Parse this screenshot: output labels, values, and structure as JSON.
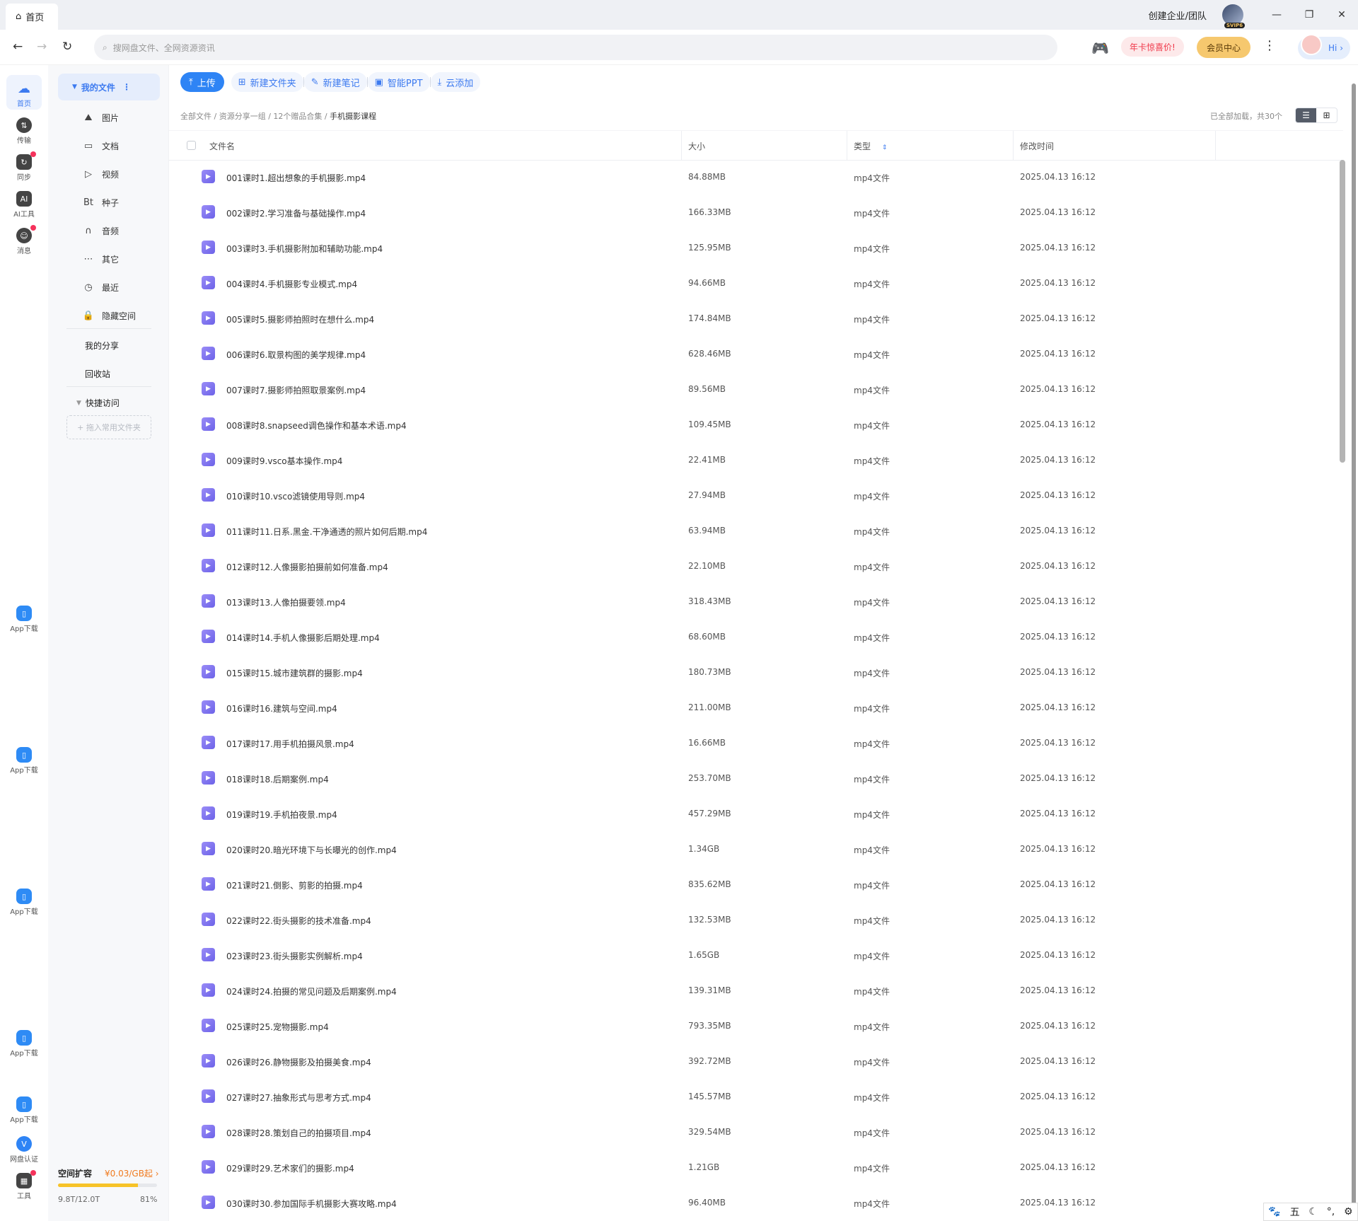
{
  "titlebar": {
    "tab_label": "首页",
    "team_label": "创建企业/团队",
    "svip_badge": "SVIP6"
  },
  "search": {
    "placeholder": "搜网盘文件、全网资源资讯"
  },
  "topbar": {
    "promo_label": "年卡惊喜价!",
    "vip_label": "会员中心",
    "hi_label": "Hi ›"
  },
  "rail": {
    "items": [
      {
        "label": "首页",
        "color": "#3c7af0"
      },
      {
        "label": "传输"
      },
      {
        "label": "同步"
      },
      {
        "label": "AI工具"
      },
      {
        "label": "消息"
      }
    ],
    "app_download": "App下载",
    "cert": "网盘认证",
    "tools": "工具"
  },
  "sidenav": {
    "my_files": "我的文件",
    "items": [
      {
        "label": "图片",
        "icon": "mountain-icon"
      },
      {
        "label": "文档",
        "icon": "document-icon"
      },
      {
        "label": "视频",
        "icon": "play-icon"
      },
      {
        "label": "种子",
        "icon": "bt-icon",
        "glyph": "Bt"
      },
      {
        "label": "音频",
        "icon": "headphones-icon"
      },
      {
        "label": "其它",
        "icon": "ellipsis-icon"
      },
      {
        "label": "最近",
        "icon": "clock-icon"
      },
      {
        "label": "隐藏空间",
        "icon": "lock-icon"
      }
    ],
    "my_share": "我的分享",
    "recycle": "回收站",
    "quick_access": "快捷访问",
    "drag_hint": "+ 拖入常用文件夹",
    "storage_title": "空间扩容",
    "storage_price": "¥0.03/GB起 ›",
    "storage_used": "9.8T/12.0T",
    "storage_percent": "81%",
    "storage_fraction": 0.81
  },
  "toolbar": {
    "upload": "上传",
    "new_folder": "新建文件夹",
    "new_note": "新建笔记",
    "smart_ppt": "智能PPT",
    "cloud_add": "云添加"
  },
  "breadcrumb": {
    "items": [
      "全部文件",
      "资源分享一组",
      "12个赠品合集"
    ],
    "current": "手机摄影课程"
  },
  "status": {
    "loaded_text": "已全部加载，共30个"
  },
  "table": {
    "headers": {
      "name": "文件名",
      "size": "大小",
      "type": "类型",
      "modified": "修改时间"
    },
    "rows": [
      {
        "name": "001课时1.超出想象的手机摄影.mp4",
        "size": "84.88MB",
        "type": "mp4文件",
        "time": "2025.04.13 16:12"
      },
      {
        "name": "002课时2.学习准备与基础操作.mp4",
        "size": "166.33MB",
        "type": "mp4文件",
        "time": "2025.04.13 16:12"
      },
      {
        "name": "003课时3.手机摄影附加和辅助功能.mp4",
        "size": "125.95MB",
        "type": "mp4文件",
        "time": "2025.04.13 16:12"
      },
      {
        "name": "004课时4.手机摄影专业模式.mp4",
        "size": "94.66MB",
        "type": "mp4文件",
        "time": "2025.04.13 16:12"
      },
      {
        "name": "005课时5.摄影师拍照时在想什么.mp4",
        "size": "174.84MB",
        "type": "mp4文件",
        "time": "2025.04.13 16:12"
      },
      {
        "name": "006课时6.取景构图的美学规律.mp4",
        "size": "628.46MB",
        "type": "mp4文件",
        "time": "2025.04.13 16:12"
      },
      {
        "name": "007课时7.摄影师拍照取景案例.mp4",
        "size": "89.56MB",
        "type": "mp4文件",
        "time": "2025.04.13 16:12"
      },
      {
        "name": "008课时8.snapseed调色操作和基本术语.mp4",
        "size": "109.45MB",
        "type": "mp4文件",
        "time": "2025.04.13 16:12"
      },
      {
        "name": "009课时9.vsco基本操作.mp4",
        "size": "22.41MB",
        "type": "mp4文件",
        "time": "2025.04.13 16:12"
      },
      {
        "name": "010课时10.vsco滤镜使用导则.mp4",
        "size": "27.94MB",
        "type": "mp4文件",
        "time": "2025.04.13 16:12"
      },
      {
        "name": "011课时11.日系.黑金.干净通透的照片如何后期.mp4",
        "size": "63.94MB",
        "type": "mp4文件",
        "time": "2025.04.13 16:12"
      },
      {
        "name": "012课时12.人像摄影拍摄前如何准备.mp4",
        "size": "22.10MB",
        "type": "mp4文件",
        "time": "2025.04.13 16:12"
      },
      {
        "name": "013课时13.人像拍摄要领.mp4",
        "size": "318.43MB",
        "type": "mp4文件",
        "time": "2025.04.13 16:12"
      },
      {
        "name": "014课时14.手机人像摄影后期处理.mp4",
        "size": "68.60MB",
        "type": "mp4文件",
        "time": "2025.04.13 16:12"
      },
      {
        "name": "015课时15.城市建筑群的摄影.mp4",
        "size": "180.73MB",
        "type": "mp4文件",
        "time": "2025.04.13 16:12"
      },
      {
        "name": "016课时16.建筑与空间.mp4",
        "size": "211.00MB",
        "type": "mp4文件",
        "time": "2025.04.13 16:12"
      },
      {
        "name": "017课时17.用手机拍摄风景.mp4",
        "size": "16.66MB",
        "type": "mp4文件",
        "time": "2025.04.13 16:12"
      },
      {
        "name": "018课时18.后期案例.mp4",
        "size": "253.70MB",
        "type": "mp4文件",
        "time": "2025.04.13 16:12"
      },
      {
        "name": "019课时19.手机拍夜景.mp4",
        "size": "457.29MB",
        "type": "mp4文件",
        "time": "2025.04.13 16:12"
      },
      {
        "name": "020课时20.暗光环境下与长曝光的创作.mp4",
        "size": "1.34GB",
        "type": "mp4文件",
        "time": "2025.04.13 16:12"
      },
      {
        "name": "021课时21.倒影、剪影的拍摄.mp4",
        "size": "835.62MB",
        "type": "mp4文件",
        "time": "2025.04.13 16:12"
      },
      {
        "name": "022课时22.街头摄影的技术准备.mp4",
        "size": "132.53MB",
        "type": "mp4文件",
        "time": "2025.04.13 16:12"
      },
      {
        "name": "023课时23.街头摄影实例解析.mp4",
        "size": "1.65GB",
        "type": "mp4文件",
        "time": "2025.04.13 16:12"
      },
      {
        "name": "024课时24.拍摄的常见问题及后期案例.mp4",
        "size": "139.31MB",
        "type": "mp4文件",
        "time": "2025.04.13 16:12"
      },
      {
        "name": "025课时25.宠物摄影.mp4",
        "size": "793.35MB",
        "type": "mp4文件",
        "time": "2025.04.13 16:12"
      },
      {
        "name": "026课时26.静物摄影及拍摄美食.mp4",
        "size": "392.72MB",
        "type": "mp4文件",
        "time": "2025.04.13 16:12"
      },
      {
        "name": "027课时27.抽象形式与思考方式.mp4",
        "size": "145.57MB",
        "type": "mp4文件",
        "time": "2025.04.13 16:12"
      },
      {
        "name": "028课时28.策划自己的拍摄项目.mp4",
        "size": "329.54MB",
        "type": "mp4文件",
        "time": "2025.04.13 16:12"
      },
      {
        "name": "029课时29.艺术家们的摄影.mp4",
        "size": "1.21GB",
        "type": "mp4文件",
        "time": "2025.04.13 16:12"
      },
      {
        "name": "030课时30.参加国际手机摄影大赛攻略.mp4",
        "size": "96.40MB",
        "type": "mp4文件",
        "time": "2025.04.13 16:12"
      }
    ]
  },
  "ime": {
    "mode": "五"
  },
  "colors": {
    "accent": "#2e84f5",
    "video_icon": "#7b6ff0",
    "storage_bar": "#f7c328",
    "badge_red": "#f5325b"
  }
}
